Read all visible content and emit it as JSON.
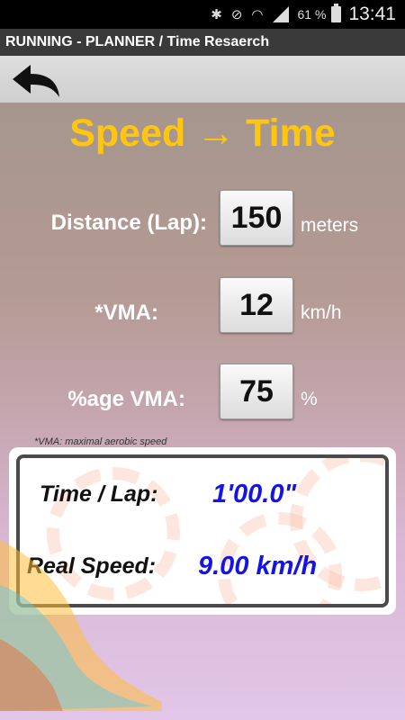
{
  "status_bar": {
    "bluetooth_icon": "bluetooth-icon",
    "mute_icon": "mute-icon",
    "wifi_icon": "wifi-icon",
    "signal_icon": "signal-icon",
    "battery_percent": "61 %",
    "battery_icon": "battery-icon",
    "time": "13:41"
  },
  "app_title": "RUNNING - PLANNER / Time Resaerch",
  "toolbar": {
    "back_icon": "back-arrow-icon"
  },
  "heading": "Speed → Time",
  "rows": [
    {
      "label": "Distance (Lap):",
      "value": "150",
      "unit": "meters"
    },
    {
      "label": "*VMA:",
      "value": "12",
      "unit": "km/h"
    },
    {
      "label": "%age VMA:",
      "value": "75",
      "unit": "%"
    }
  ],
  "footnote": "*VMA: maximal aerobic speed",
  "results": {
    "time_label": "Time / Lap:",
    "time_value": "1'00.0\"",
    "speed_label": "Real Speed:",
    "speed_value": "9.00 km/h"
  },
  "colors": {
    "heading": "#ffc610",
    "result_value": "#1414e6",
    "title_bar": "#3a3a3a"
  }
}
